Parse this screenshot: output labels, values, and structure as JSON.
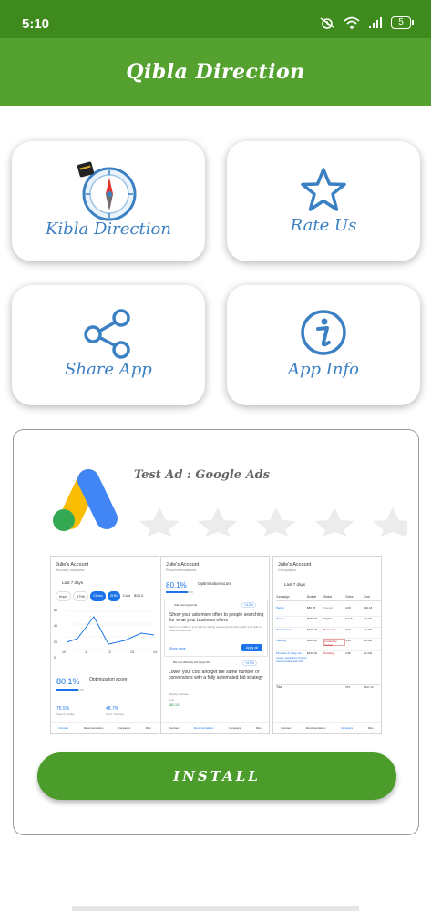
{
  "status_bar": {
    "time": "5:10",
    "battery": "5"
  },
  "app_bar": {
    "title": "Qibla Direction"
  },
  "tiles": [
    {
      "label": "Kibla Direction",
      "icon": "compass-icon"
    },
    {
      "label": "Rate Us",
      "icon": "star-icon"
    },
    {
      "label": "Share App",
      "icon": "share-icon"
    },
    {
      "label": "App Info",
      "icon": "info-icon"
    }
  ],
  "ad": {
    "title": "Test Ad : Google Ads",
    "rating_stars": 0,
    "install_label": "INSTALL",
    "screenshots": [
      {
        "account": "Julie's Account",
        "subtitle": "Account overview",
        "date_range": "Last 7 days",
        "stats": [
          "Impr.",
          "479K",
          "Clicks",
          "2HD",
          "Cost",
          "$34.0"
        ],
        "score_value": "80.1%",
        "score_label": "Optimization score",
        "metrics": [
          "75.5%",
          "48.7%"
        ],
        "metric_labels": [
          "Search Quality",
          "Conv. Tracking"
        ],
        "x_ticks": [
          "10",
          "11",
          "12",
          "13",
          "14"
        ],
        "y_ticks": [
          "60",
          "40",
          "20",
          "0"
        ],
        "nav": [
          "Overview",
          "Recommendations",
          "Campaigns",
          "More"
        ]
      },
      {
        "account": "Julie's Account",
        "subtitle": "Recommendations",
        "score_value": "80.1%",
        "score_label": "Optimization score",
        "card1_label": "Add new keywords",
        "card1_badge": "+4.2%",
        "card1_title": "Show your ads more often to people searching for what your business offers",
        "card1_body": "Get more traffic to your ads by adding new keywords that match your ads to relevant searches",
        "card1_link": "Show more",
        "card1_button": "Apply all",
        "card2_label": "Bid more efficiently with Target CPA",
        "card2_badge": "+4.3%",
        "card2_title": "Lower your cost and get the same number of conversions with a fully automated bid strategy",
        "card2_meta": "Weekly estimate",
        "card2_cost_label": "Cost",
        "card2_cost": "-$0.13",
        "nav": [
          "Overview",
          "Recommendations",
          "Campaigns",
          "More"
        ]
      },
      {
        "account": "Julie's Account",
        "subtitle": "Campaigns",
        "date_range": "Last 7 days",
        "columns": [
          "Campaign",
          "Budget",
          "Status",
          "Clicks",
          "Cost"
        ],
        "rows": [
          [
            "Parker",
            "$80.78",
            "Paused",
            "4.6K",
            "$92.18"
          ],
          [
            "Pauline",
            "$980.38",
            "Eligible",
            "8.22K",
            "$2,304"
          ],
          [
            "Parvati Cutis",
            "$360.18",
            "Removed",
            "6.9K",
            "$1,794"
          ],
          [
            "Padding",
            "$360.18",
            "Limited by budget",
            "4.1K",
            "$1,304"
          ],
          [
            "Pinnacle & Indigo lim. create music from broken music bottles and mills",
            "$320.18",
            "Pending",
            "2.9K",
            "$1,344"
          ]
        ],
        "total_label": "Total",
        "total_clicks": "375",
        "total_cost": "$527.12",
        "nav": [
          "Overview",
          "Recommendations",
          "Campaigns",
          "More"
        ]
      }
    ]
  },
  "colors": {
    "status_bar": "#3f8a1c",
    "app_bar": "#55a130",
    "tile_text": "#3c80c4",
    "install": "#4c9c2c",
    "ads_blue": "#4285f4",
    "ads_yellow": "#fbbc04",
    "ads_green": "#34a853"
  }
}
